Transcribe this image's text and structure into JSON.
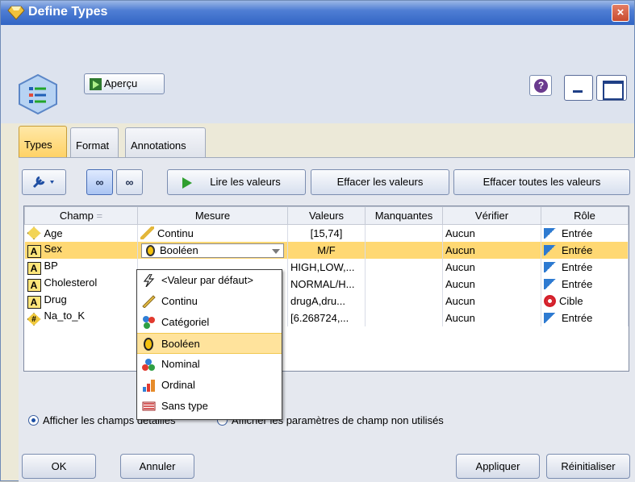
{
  "window": {
    "title": "Define Types"
  },
  "header": {
    "preview_label": "Aperçu"
  },
  "tabs": [
    "Types",
    "Format",
    "Annotations"
  ],
  "toolbar": {
    "read_values_label": "Lire les valeurs",
    "clear_values_label": "Effacer les valeurs",
    "clear_all_values_label": "Effacer toutes les valeurs"
  },
  "table": {
    "headers": [
      "Champ",
      "Mesure",
      "Valeurs",
      "Manquantes",
      "Vérifier",
      "Rôle"
    ],
    "rows": [
      {
        "field": "Age",
        "measure": "Continu",
        "values": "[15,74]",
        "missing": "",
        "check": "Aucun",
        "role": "Entrée"
      },
      {
        "field": "Sex",
        "measure": "Booléen",
        "values": "M/F",
        "missing": "",
        "check": "Aucun",
        "role": "Entrée"
      },
      {
        "field": "BP",
        "measure": "",
        "values": "HIGH,LOW,...",
        "missing": "",
        "check": "Aucun",
        "role": "Entrée"
      },
      {
        "field": "Cholesterol",
        "measure": "",
        "values": "NORMAL/H...",
        "missing": "",
        "check": "Aucun",
        "role": "Entrée"
      },
      {
        "field": "Drug",
        "measure": "",
        "values": "drugA,dru...",
        "missing": "",
        "check": "Aucun",
        "role": "Cible"
      },
      {
        "field": "Na_to_K",
        "measure": "",
        "values": "[6.268724,...",
        "missing": "",
        "check": "Aucun",
        "role": "Entrée"
      }
    ]
  },
  "measure_dropdown": {
    "items": [
      "<Valeur par défaut>",
      "Continu",
      "Catégoriel",
      "Booléen",
      "Nominal",
      "Ordinal",
      "Sans type"
    ],
    "selected": "Booléen"
  },
  "options": {
    "show_fields_label": "Afficher les champs",
    "show_fields_tail": "détaillés",
    "hide_unused_prefix": "Afficher",
    "hide_unused_label": "les paramètres de champ non utilisés"
  },
  "footer": {
    "ok_label": "OK",
    "cancel_label": "Annuler",
    "apply_label": "Appliquer",
    "reset_label": "Réinitialiser"
  }
}
